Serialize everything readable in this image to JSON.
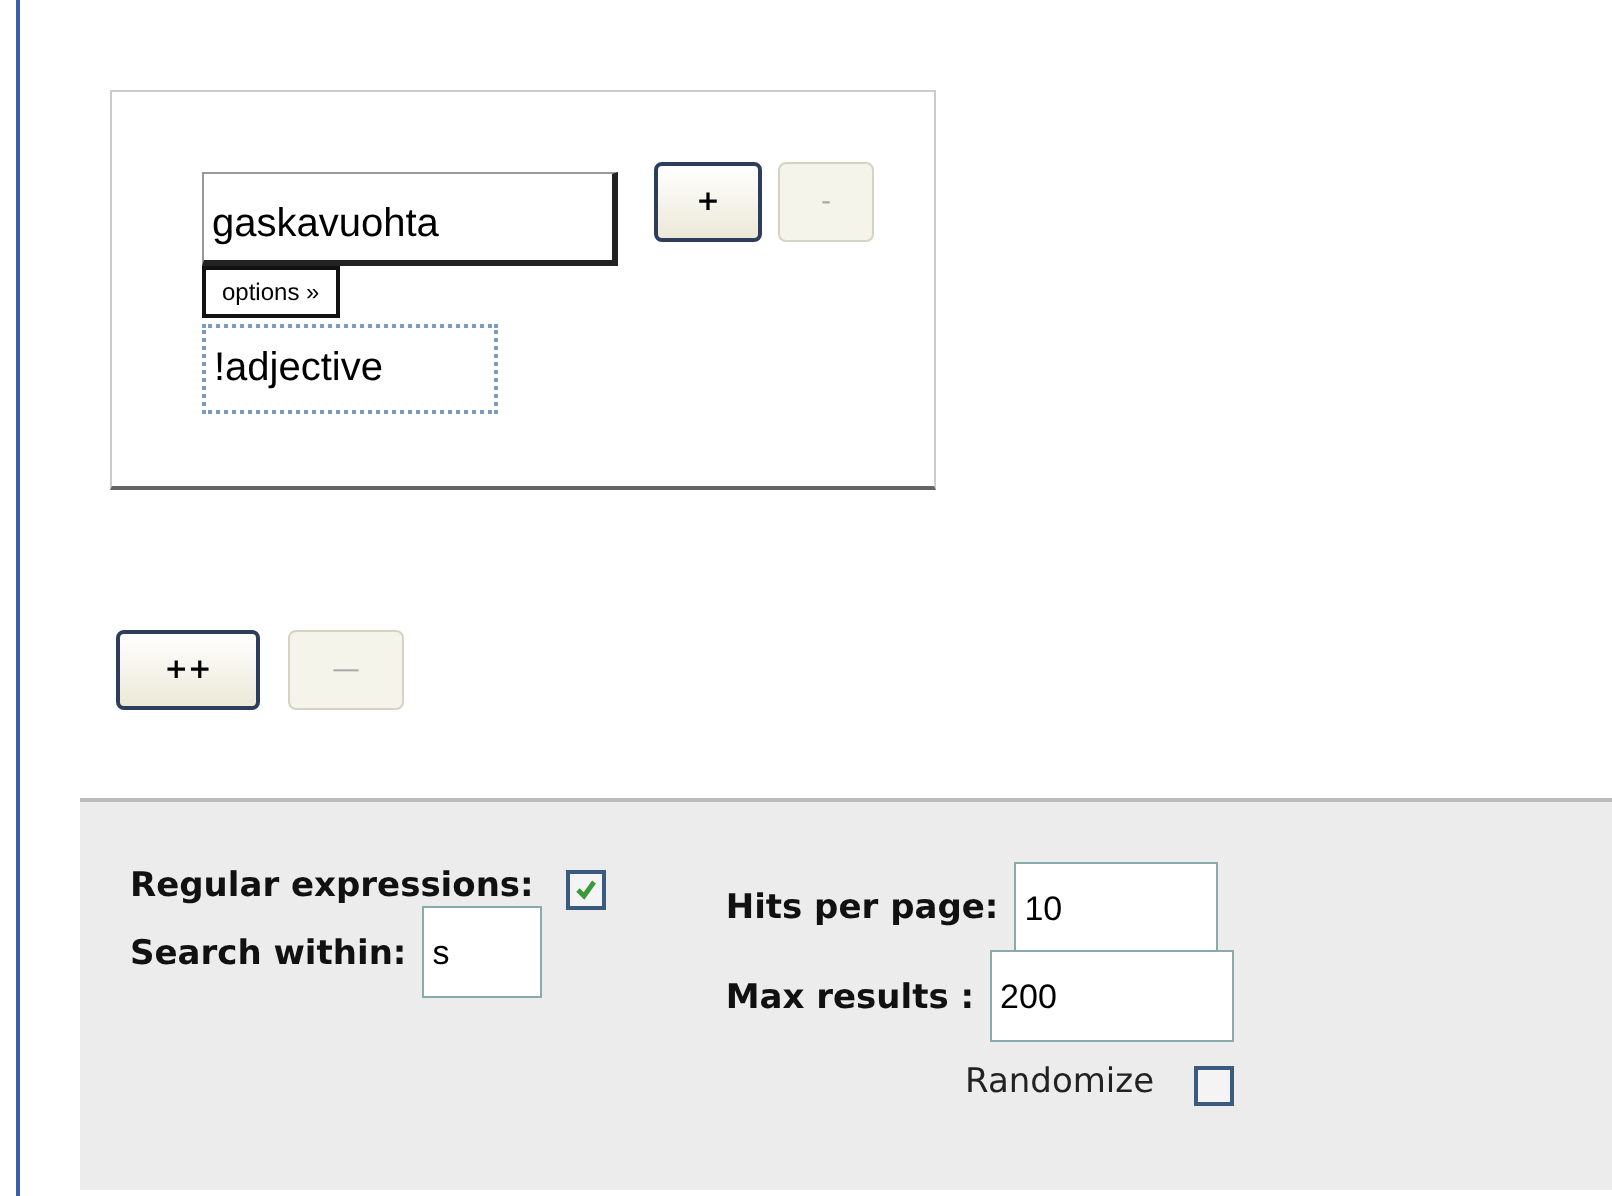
{
  "term": {
    "value": "gaskavuohta",
    "add_button": "+",
    "remove_button": "-",
    "remove_disabled": true,
    "options_button": "options »",
    "filter": "!adjective"
  },
  "add_term_button": "++",
  "remove_term_button": "—",
  "remove_term_disabled": true,
  "settings": {
    "regex_label": "Regular expressions:",
    "regex_checked": true,
    "search_within_label": "Search within:",
    "search_within": "s",
    "hits_label": "Hits per page:",
    "hits": "10",
    "max_label": "Max results :",
    "max": "200",
    "randomize_label": "Randomize",
    "randomize_checked": false
  }
}
